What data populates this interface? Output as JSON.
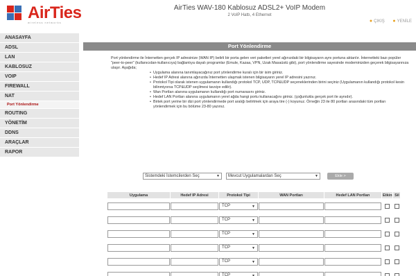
{
  "header": {
    "logo_text": "AirTies",
    "logo_subtitle": "wireless networks",
    "title": "AirTies WAV-180 Kablosuz ADSL2+ VoIP Modem",
    "subtitle": "2 VoIP Hattı, 4 Ethernet",
    "links": [
      "ÇIKIŞ",
      "YENİLE"
    ],
    "brand_color": "#d9261c"
  },
  "sidebar": {
    "items": [
      {
        "label": "ANASAYFA"
      },
      {
        "label": "ADSL"
      },
      {
        "label": "LAN"
      },
      {
        "label": "KABLOSUZ"
      },
      {
        "label": "VOIP"
      },
      {
        "label": "FIREWALL"
      },
      {
        "label": "NAT"
      },
      {
        "label": "Port Yönlendirme",
        "sub": true
      },
      {
        "label": "ROUTING"
      },
      {
        "label": "YÖNETİM"
      },
      {
        "label": "DDNS"
      },
      {
        "label": "ARAÇLAR"
      },
      {
        "label": "RAPOR"
      }
    ]
  },
  "main": {
    "section_title": "Port Yönlendirme",
    "intro": "Port yönlendirme ile İnternetten gerçek IP adresinize (WAN IP) belirli bir porta gelen veri paketleri yerel ağınızdaki bir bilgisayarın aynı portuna aktarılır. İnternetteki bazı popüler \"peer-to-peer\" (kullanıcıdan-kullanıcıya) bağlantıya dayalı programlar (Emule, Kazaa, VPN, Uzak Masaüstü gibi), port yönlendirme sayesinde modeminizden geçerek bilgisayarınıza ulaşır. Aşağıda;",
    "bullets": [
      "Uygulama alanına tanımlayacağınız port yönlendirme kuralı için bir isim giriniz.",
      "Hedef IP Adresi alanına ağınızda İnternetten ulaşmak istenen bilgisayarın yerel IP adresini yazınız.",
      "Protokol Tipi olarak istenen uygulamanın kullandığı protokol TCP, UDP, TCP&UDP seçeneklerinden birini seçiniz (Uygulamanın kullandığı protokol kesin bilinmiyorsa TCP&UDP seçilmesi tavsiye edilir).",
      "Wan Portları alanına uygulamanın kullandığı port numarasını giriniz.",
      "Hedef LAN Portları alanına uygulamanın yerel ağda hangi portu kullanacağını giriniz. (çoğunlukla gerçek port ile aynıdır).",
      "Birtek port yerine bir dizi port yönlendirmede port aralığı belirtmek için araya tire (-) koyunuz. Örneğin 23 ile 80 portları arasındaki tüm portları yönlendirmek için bu bölüme 23-80 yazınız."
    ],
    "select_client": "Sistemdeki İstemcilerden Seç",
    "select_app": "Mevcut Uygulamalardan Seç",
    "add_button": "Ekle >",
    "table": {
      "headers": [
        "Uygulama",
        "Hedef IP Adresi",
        "Protokol Tipi",
        "WAN Portları",
        "Hedef LAN Portları",
        "Etkin",
        "Sil"
      ],
      "rows": [
        {
          "protocol": "TCP"
        },
        {
          "protocol": "TCP"
        },
        {
          "protocol": "TCP"
        },
        {
          "protocol": "TCP"
        },
        {
          "protocol": "TCP"
        },
        {
          "protocol": "TCP"
        }
      ]
    }
  }
}
